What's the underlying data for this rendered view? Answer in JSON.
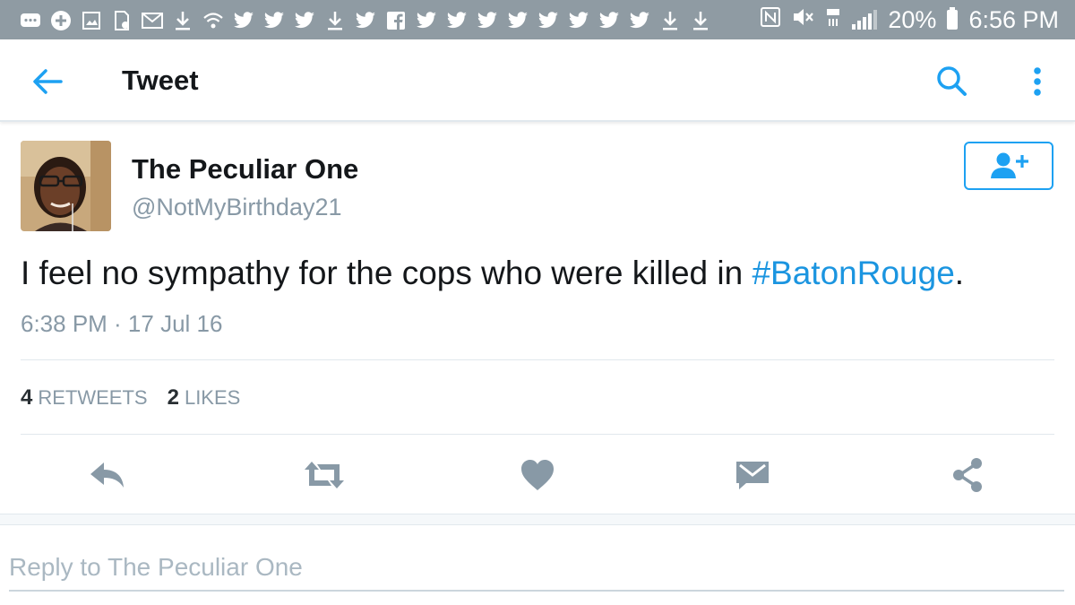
{
  "status_bar": {
    "notification_icons": [
      "chat-icon",
      "add-icon",
      "image-icon",
      "sim-icon",
      "mail-icon",
      "download-icon",
      "wifi-icon",
      "twitter-icon",
      "twitter-icon",
      "twitter-icon",
      "download-icon",
      "twitter-icon",
      "facebook-icon",
      "twitter-icon",
      "twitter-icon",
      "twitter-icon",
      "twitter-icon",
      "twitter-icon",
      "twitter-icon",
      "twitter-icon",
      "twitter-icon",
      "download-icon",
      "download-icon"
    ],
    "battery": "20%",
    "time": "6:56 PM"
  },
  "app_bar": {
    "title": "Tweet"
  },
  "tweet": {
    "display_name": "The Peculiar One",
    "handle": "@NotMyBirthday21",
    "text_before": "I feel no sympathy for the cops who were killed in ",
    "hashtag": "#BatonRouge",
    "text_after": ".",
    "timestamp": "6:38 PM · 17 Jul 16",
    "retweet_count": "4",
    "retweet_label": "RETWEETS",
    "like_count": "2",
    "like_label": "LIKES"
  },
  "reply": {
    "placeholder": "Reply to The Peculiar One"
  },
  "colors": {
    "accent": "#1da1f2",
    "status_bar": "#8f9ba3",
    "muted": "#8899a6",
    "action_icons": "#8899a6"
  }
}
